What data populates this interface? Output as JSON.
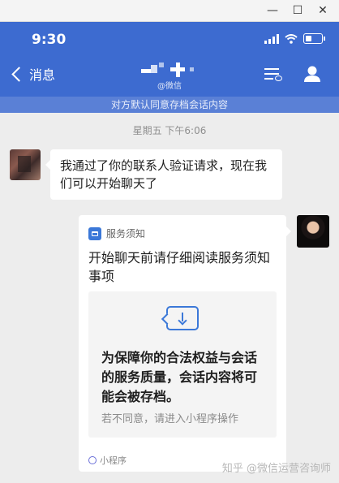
{
  "window": {
    "minimize_icon": "minimize-icon",
    "maximize_icon": "maximize-icon",
    "close_icon": "close-icon",
    "minimize_glyph": "—",
    "maximize_glyph": "☐",
    "close_glyph": "✕"
  },
  "status_bar": {
    "time": "9:30",
    "icons": [
      "signal-icon",
      "wifi-icon",
      "battery-icon"
    ]
  },
  "header": {
    "back_label": "消息",
    "subtitle": "@微信",
    "accent_color": "#3d6bd0"
  },
  "notice_bar": {
    "text": "对方默认同意存档会话内容"
  },
  "chat": {
    "timestamp": "星期五 下午6:06",
    "incoming_message": "我通过了你的联系人验证请求，现在我们可以开始聊天了",
    "card": {
      "service_label": "服务须知",
      "title": "开始聊天前请仔细阅读服务须知事项",
      "body": "为保障你的合法权益与会话的服务质量，会话内容将可能会被存档。",
      "sub": "若不同意，请进入小程序操作",
      "footer": "小程序"
    }
  },
  "watermark": "知乎 @微信运营咨询师"
}
